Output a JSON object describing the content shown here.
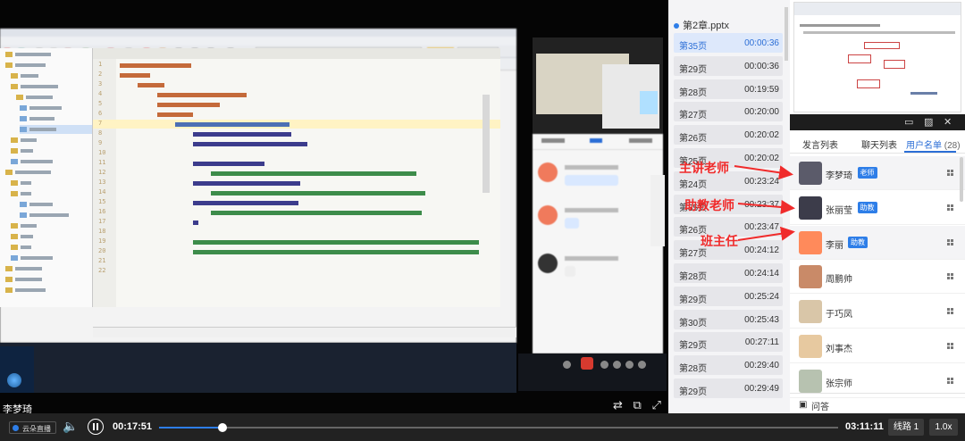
{
  "slide_panel": {
    "file_name": "第2章.pptx",
    "items": [
      {
        "page": "第35页",
        "time": "00:00:36",
        "active": true
      },
      {
        "page": "第29页",
        "time": "00:00:36"
      },
      {
        "page": "第28页",
        "time": "00:19:59"
      },
      {
        "page": "第27页",
        "time": "00:20:00"
      },
      {
        "page": "第26页",
        "time": "00:20:02"
      },
      {
        "page": "第25页",
        "time": "00:20:02"
      },
      {
        "page": "第24页",
        "time": "00:23:24"
      },
      {
        "page": "第35页",
        "time": "00:23:37"
      },
      {
        "page": "第26页",
        "time": "00:23:47"
      },
      {
        "page": "第27页",
        "time": "00:24:12"
      },
      {
        "page": "第28页",
        "time": "00:24:14"
      },
      {
        "page": "第29页",
        "time": "00:25:24"
      },
      {
        "page": "第30页",
        "time": "00:25:43"
      },
      {
        "page": "第29页",
        "time": "00:27:11"
      },
      {
        "page": "第28页",
        "time": "00:29:40"
      },
      {
        "page": "第29页",
        "time": "00:29:49"
      }
    ]
  },
  "right_panel": {
    "tabs": [
      {
        "label": "发言列表"
      },
      {
        "label": "聊天列表"
      },
      {
        "label": "用户名单",
        "active": true
      }
    ],
    "user_count": "(28)",
    "users": [
      {
        "name": "李梦琦",
        "badge": "老师",
        "avatar_color": "#5b5b6a"
      },
      {
        "name": "张丽莹",
        "badge": "助教",
        "avatar_color": "#3c3c4a"
      },
      {
        "name": "李丽",
        "badge": "助教",
        "avatar_color": "#ff8a5b"
      },
      {
        "name": "周鹏帅",
        "badge": "",
        "avatar_color": "#c98a68"
      },
      {
        "name": "于巧凤",
        "badge": "",
        "avatar_color": "#d9c6a8"
      },
      {
        "name": "刘事杰",
        "badge": "",
        "avatar_color": "#e7c9a0"
      },
      {
        "name": "张宗师",
        "badge": "",
        "avatar_color": "#b7c2b0"
      }
    ],
    "qa_label": "问答"
  },
  "annotations": [
    {
      "label": "主讲老师"
    },
    {
      "label": "助教老师"
    },
    {
      "label": "班主任"
    }
  ],
  "video": {
    "speaker_name": "李梦琦"
  },
  "player": {
    "live_label": "云朵直播",
    "current_time": "00:17:51",
    "total_time": "03:11:11",
    "progress_fraction": 0.093,
    "route_label": "线路 1",
    "speed_label": "1.0x"
  },
  "colors": {
    "accent": "#2e7ee8",
    "annotation": "#f02b2b",
    "player_bg": "#222222"
  }
}
